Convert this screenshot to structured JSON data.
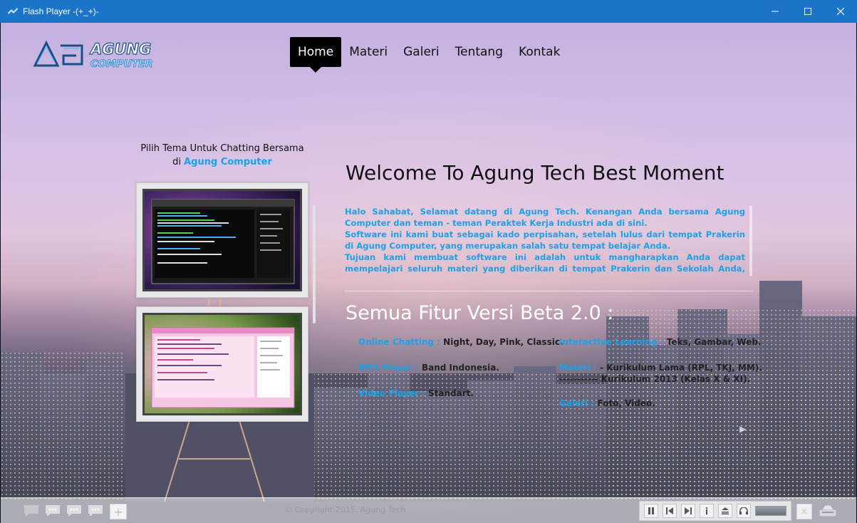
{
  "window": {
    "title": "Flash Player  -(+_+)-"
  },
  "logo": {
    "line1": "AGUNG",
    "line2": "COMPUTER"
  },
  "nav": {
    "items": [
      {
        "label": "Home",
        "active": true
      },
      {
        "label": "Materi"
      },
      {
        "label": "Galeri"
      },
      {
        "label": "Tentang"
      },
      {
        "label": "Kontak"
      }
    ]
  },
  "themes": {
    "caption_line1": "Pilih Tema Untuk Chatting Bersama",
    "caption_prefix": "di ",
    "caption_accent": "Agung Computer",
    "thumbnails": [
      {
        "theme": "dark"
      },
      {
        "theme": "pink"
      }
    ]
  },
  "welcome": {
    "title": "Welcome To Agung Tech Best Moment",
    "paragraphs": [
      "Halo Sahabat, Selamat datang di Agung Tech. Kenangan Anda bersama Agung Computer dan teman - teman Peraktek Kerja Industri ada di sini.",
      "Software ini kami buat sebagai kado perpisahan, setelah lulus dari tempat Prakerin di Agung Computer, yang merupakan salah satu tempat belajar Anda.",
      "Tujuan kami membuat software ini adalah untuk mangharapkan Anda dapat mempelajari seluruh materi yang diberikan di tempat Prakerin dan Sekolah Anda, karena banyak di antara kalian yang"
    ]
  },
  "features": {
    "title": "Semua Fitur Versi Beta 2.0 :",
    "left": [
      {
        "key": "Online Chatting :",
        "value": " Night, Day, Pink, Classic."
      },
      {
        "key": "MP3 Player :",
        "value": " Band Indonesia."
      },
      {
        "key": "Video Player :",
        "value": " Standart."
      }
    ],
    "right": [
      {
        "key": "Interactive Learning :",
        "value": " Teks, Gambar, Web."
      },
      {
        "key": "Materi :",
        "value": " - Kurikulum Lama (RPL, TKJ, MM).",
        "extra": "----------- Kurikulum 2013 (Kelas X & XI)."
      },
      {
        "key": "Galeri :",
        "value": " Foto, Video."
      }
    ]
  },
  "footer": {
    "copyright": "© Copyright 2015, Agung Tech"
  },
  "colors": {
    "accent": "#1aa3e8",
    "titlebar": "#1c74c8"
  }
}
